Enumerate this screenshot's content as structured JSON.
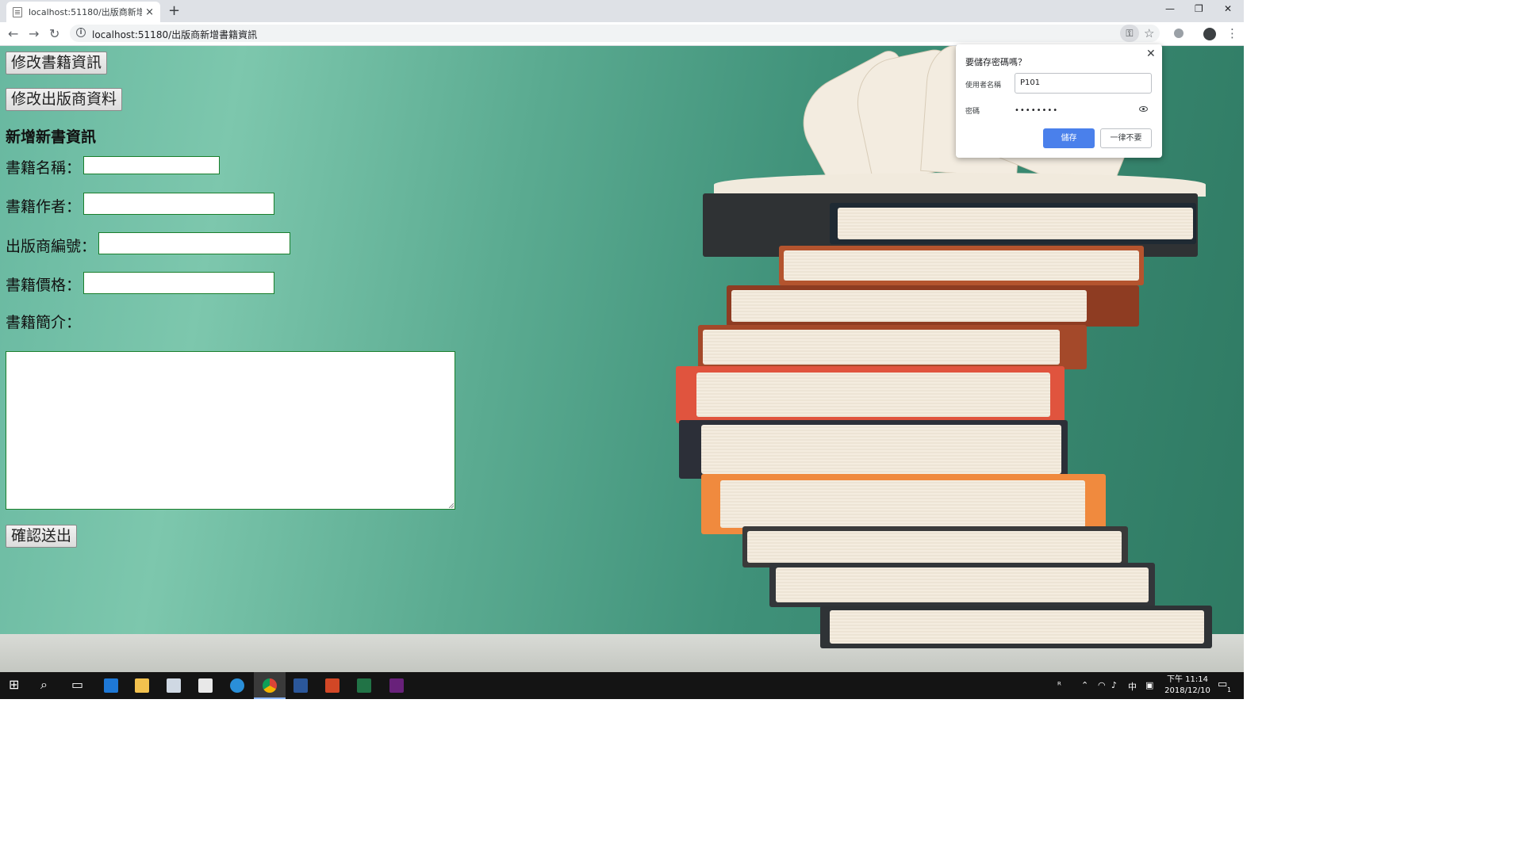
{
  "browser": {
    "tab_title": "localhost:51180/出版商新增書籍",
    "tab_close": "×",
    "new_tab": "+",
    "url": "localhost:51180/出版商新增書籍資訊",
    "window_controls": {
      "minimize": "—",
      "restore": "❐",
      "close": "✕"
    },
    "nav": {
      "back": "←",
      "forward": "→",
      "reload": "↻"
    }
  },
  "page": {
    "edit_books_button": "修改書籍資訊",
    "edit_publisher_button": "修改出版商資料",
    "section_heading": "新增新書資訊",
    "fields": {
      "book_name_label": "書籍名稱：",
      "book_author_label": "書籍作者：",
      "publisher_id_label": "出版商編號：",
      "book_price_label": "書籍價格：",
      "book_intro_label": "書籍簡介："
    },
    "submit_button": "確認送出"
  },
  "password_bubble": {
    "title": "要儲存密碼嗎？",
    "close": "✕",
    "username_label": "使用者名稱",
    "username_value": "P101",
    "password_label": "密碼",
    "password_value": "••••••••",
    "save_button": "儲存",
    "never_button": "一律不要"
  },
  "taskbar": {
    "clock_time": "下午 11:14",
    "clock_date": "2018/12/10",
    "ime": "中",
    "notification_count": "1"
  },
  "colors": {
    "chalkboard": "#3f9179",
    "field_border": "#1a7f2c",
    "save_button": "#4a80eb",
    "taskbar": "#141414"
  }
}
